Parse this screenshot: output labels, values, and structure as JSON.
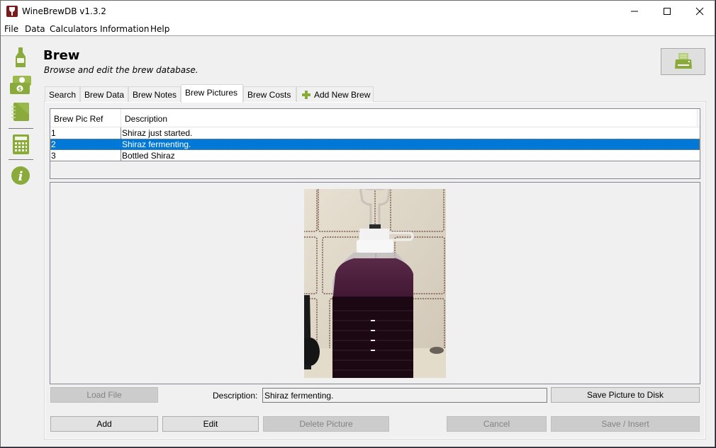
{
  "window": {
    "title": "WineBrewDB v1.3.2",
    "controls": {
      "minimize": "—",
      "maximize": "☐",
      "close": "✕"
    }
  },
  "menubar": {
    "items": [
      "File",
      "Data",
      "Calculators",
      "Information",
      "Help"
    ]
  },
  "sidebar": {
    "items": [
      {
        "name": "wine-bottle-icon",
        "label": "Brew"
      },
      {
        "name": "money-icon",
        "label": "Costs"
      },
      {
        "name": "notebook-icon",
        "label": "Notes"
      },
      {
        "name": "calculator-icon",
        "label": "Calculators"
      },
      {
        "name": "info-icon",
        "label": "Information"
      }
    ]
  },
  "header": {
    "title": "Brew",
    "subtitle": "Browse and edit the brew database.",
    "print_icon": "printer-icon"
  },
  "tabs": [
    {
      "label": "Search",
      "active": false
    },
    {
      "label": "Brew Data",
      "active": false
    },
    {
      "label": "Brew Notes",
      "active": false
    },
    {
      "label": "Brew Pictures",
      "active": true
    },
    {
      "label": "Brew Costs",
      "active": false
    },
    {
      "label": "Add New Brew",
      "active": false,
      "icon": "plus-icon"
    }
  ],
  "table": {
    "columns": [
      "Brew Pic Ref",
      "Description"
    ],
    "rows": [
      {
        "ref": "1",
        "description": "Shiraz just started.",
        "selected": false
      },
      {
        "ref": "2",
        "description": "Shiraz fermenting.",
        "selected": true
      },
      {
        "ref": "3",
        "description": "Bottled Shiraz",
        "selected": false
      }
    ]
  },
  "picture": {
    "alt": "Demijohn of Shiraz fermenting with airlock"
  },
  "form": {
    "load_file_label": "Load File",
    "description_label": "Description:",
    "description_value": "Shiraz fermenting.",
    "save_picture_label": "Save Picture to Disk",
    "add_label": "Add",
    "edit_label": "Edit",
    "delete_label": "Delete Picture",
    "cancel_label": "Cancel",
    "save_insert_label": "Save / Insert"
  },
  "colors": {
    "accent_green": "#8aab3c",
    "selection_blue": "#0078d7"
  }
}
